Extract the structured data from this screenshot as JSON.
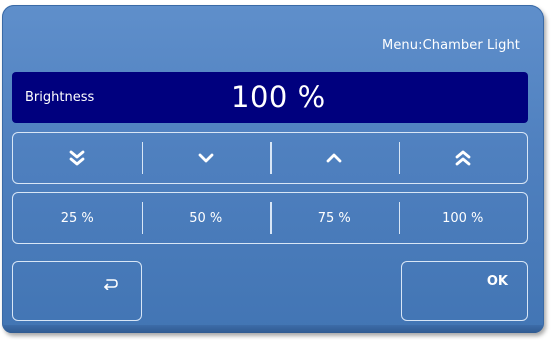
{
  "header": {
    "menu_title": "Menu:Chamber Light"
  },
  "display": {
    "label": "Brightness",
    "value": "100 %"
  },
  "step_buttons": [
    {
      "icon": "double-chevron-down-icon"
    },
    {
      "icon": "chevron-down-icon"
    },
    {
      "icon": "chevron-up-icon"
    },
    {
      "icon": "double-chevron-up-icon"
    }
  ],
  "presets": [
    "25 %",
    "50 %",
    "75 %",
    "100 %"
  ],
  "footer": {
    "back_icon": "return-arrow-icon",
    "ok_label": "OK"
  },
  "colors": {
    "panel": "#4f80bf",
    "display_bar": "#00007e",
    "border": "#d8e6f6",
    "text": "#ffffff"
  }
}
